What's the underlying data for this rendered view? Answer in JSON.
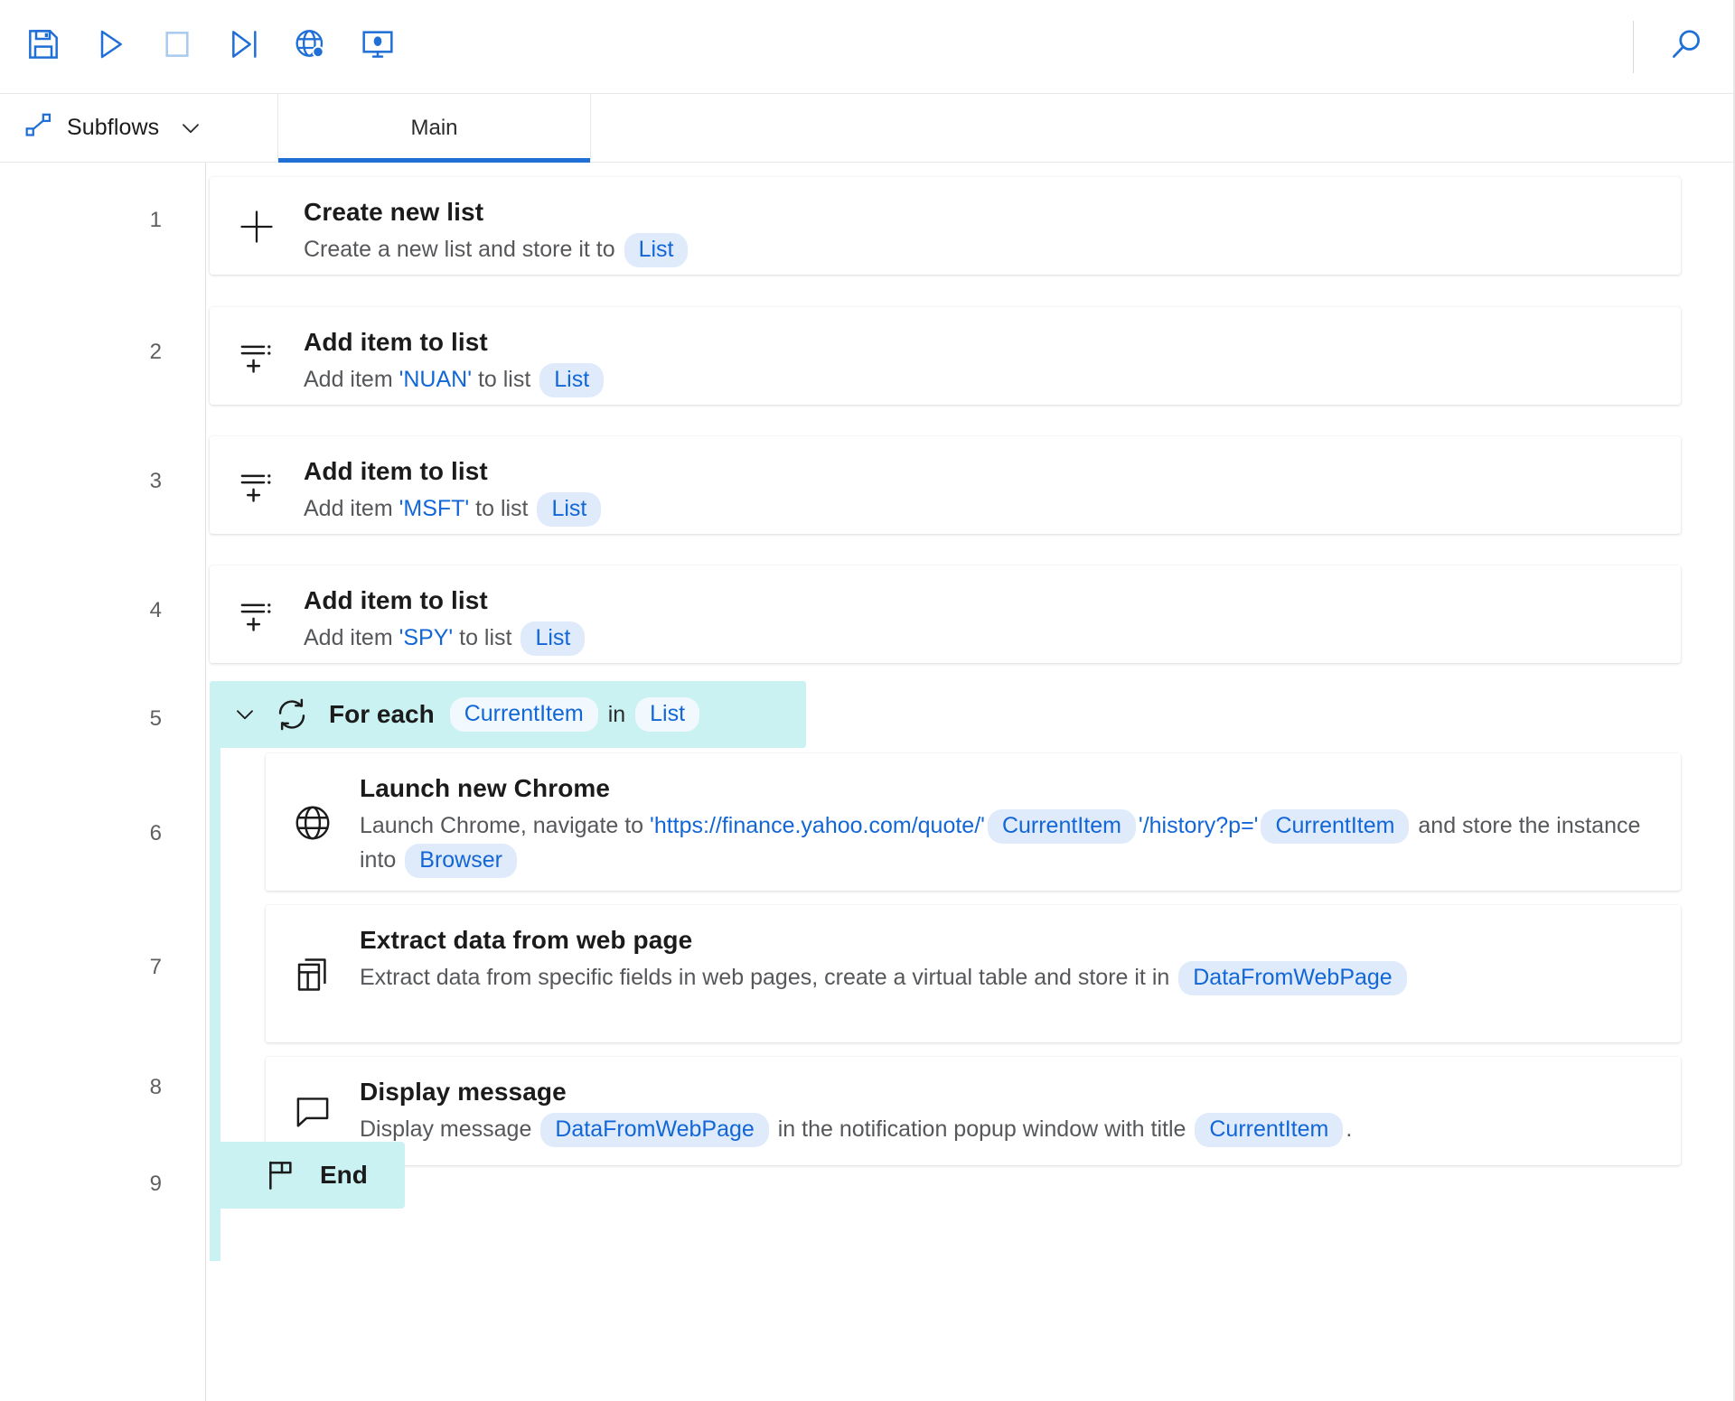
{
  "toolbar": {
    "buttons": [
      {
        "name": "save-button",
        "icon": "save-icon",
        "label": "Save"
      },
      {
        "name": "run-button",
        "icon": "play-icon",
        "label": "Run"
      },
      {
        "name": "stop-button",
        "icon": "stop-icon",
        "label": "Stop"
      },
      {
        "name": "run-next-action-button",
        "icon": "run-next-action-icon",
        "label": "Run next action"
      },
      {
        "name": "web-recorder-button",
        "icon": "globe-record-icon",
        "label": "Web recorder"
      },
      {
        "name": "desktop-recorder-button",
        "icon": "desktop-record-icon",
        "label": "Desktop recorder"
      }
    ],
    "search": {
      "name": "search-button",
      "icon": "search-icon",
      "label": "Search"
    }
  },
  "tabbar": {
    "subflows_label": "Subflows",
    "subflows_icon": "subflow-icon",
    "chevron_icon": "chevron-down-icon",
    "tabs": [
      {
        "label": "Main",
        "active": true
      }
    ]
  },
  "colors": {
    "accent": "#1f6fd6",
    "pill_bg": "#dfebfb",
    "pill_text": "#1266d6",
    "loop_bg": "#cbf2f2",
    "title_text": "#1b1b1b",
    "desc_text": "#55575a"
  },
  "line_numbers": [
    "1",
    "2",
    "3",
    "4",
    "5",
    "6",
    "7",
    "8",
    "9"
  ],
  "actions": [
    {
      "line": "1",
      "icon": "plus-icon",
      "title": "Create new list",
      "parts": [
        {
          "type": "text",
          "value": "Create a new list and store it to "
        },
        {
          "type": "pill",
          "value": "List"
        }
      ]
    },
    {
      "line": "2",
      "icon": "add-item-to-list-icon",
      "title": "Add item to list",
      "parts": [
        {
          "type": "text",
          "value": "Add item "
        },
        {
          "type": "literal",
          "value": "'NUAN'"
        },
        {
          "type": "text",
          "value": " to list "
        },
        {
          "type": "pill",
          "value": "List"
        }
      ]
    },
    {
      "line": "3",
      "icon": "add-item-to-list-icon",
      "title": "Add item to list",
      "parts": [
        {
          "type": "text",
          "value": "Add item "
        },
        {
          "type": "literal",
          "value": "'MSFT'"
        },
        {
          "type": "text",
          "value": " to list "
        },
        {
          "type": "pill",
          "value": "List"
        }
      ]
    },
    {
      "line": "4",
      "icon": "add-item-to-list-icon",
      "title": "Add item to list",
      "parts": [
        {
          "type": "text",
          "value": "Add item "
        },
        {
          "type": "literal",
          "value": "'SPY'"
        },
        {
          "type": "text",
          "value": " to list "
        },
        {
          "type": "pill",
          "value": "List"
        }
      ]
    }
  ],
  "loop": {
    "line": "5",
    "chevron_icon": "chevron-down-icon",
    "icon": "loop-icon",
    "title": "For each",
    "variable": "CurrentItem",
    "word_in": "in",
    "collection": "List",
    "children": [
      {
        "line": "6",
        "icon": "globe-icon",
        "title": "Launch new Chrome",
        "parts": [
          {
            "type": "text",
            "value": "Launch Chrome, navigate to "
          },
          {
            "type": "literal",
            "value": "'https://finance.yahoo.com/quote/'"
          },
          {
            "type": "pill",
            "value": "CurrentItem"
          },
          {
            "type": "literal",
            "value": "'/history?p='"
          },
          {
            "type": "pill",
            "value": "CurrentItem"
          },
          {
            "type": "text",
            "value": " and store the instance into "
          },
          {
            "type": "pill",
            "value": "Browser"
          }
        ]
      },
      {
        "line": "7",
        "icon": "extract-data-icon",
        "title": "Extract data from web page",
        "parts": [
          {
            "type": "text",
            "value": "Extract data from specific fields in web pages, create a virtual table and store it in "
          },
          {
            "type": "pill",
            "value": "DataFromWebPage"
          }
        ]
      },
      {
        "line": "8",
        "icon": "message-icon",
        "title": "Display message",
        "parts": [
          {
            "type": "text",
            "value": "Display message "
          },
          {
            "type": "pill",
            "value": "DataFromWebPage"
          },
          {
            "type": "text",
            "value": " in the notification popup window with title "
          },
          {
            "type": "pill",
            "value": "CurrentItem"
          },
          {
            "type": "text",
            "value": "."
          }
        ]
      }
    ],
    "end": {
      "line": "9",
      "icon": "flag-icon",
      "label": "End"
    }
  }
}
